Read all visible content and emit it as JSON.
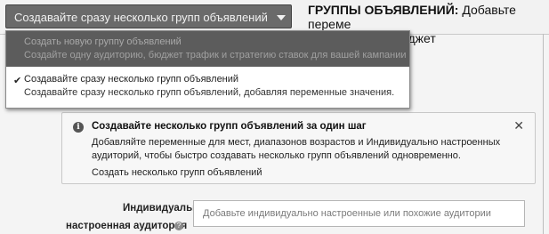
{
  "dropdown": {
    "selected_label": "Создавайте сразу несколько групп объявлений"
  },
  "header": {
    "title_bold": "ГРУППЫ ОБЪЯВЛЕНИЙ:",
    "title_rest": " Добавьте переме",
    "title_line2": "распределять бюджет"
  },
  "menu": {
    "items": [
      {
        "title": "Создать новую группу объявлений",
        "description": "Создайте одну аудиторию, бюджет трафик и стратегию ставок для вашей кампании",
        "selected": false
      },
      {
        "title": "Создавайте сразу несколько групп объявлений",
        "description": "Создавайте сразу несколько групп объявлений, добавляя переменные значения.",
        "selected": true
      }
    ],
    "check_glyph": "✔"
  },
  "info": {
    "icon": "i",
    "title": "Создавайте несколько групп объявлений за один шаг",
    "text": "Добавляйте переменные для мест, диапазонов возрастов и Индивидуально настроенных аудиторий, чтобы быстро создавать несколько групп объявлений одновременно.",
    "link": "Создать несколько групп объявлений",
    "close_glyph": "✕"
  },
  "audience": {
    "label_line1": "Индивидуально",
    "label_line2": "настроенная аудитория",
    "placeholder": "Добавьте индивидуально настроенные или похожие аудитории"
  },
  "icons": {
    "info_icon": "info-circle-icon",
    "help_icon": "question-circle-icon",
    "close_icon": "close-icon",
    "caret_icon": "chevron-down-icon",
    "check_icon": "checkmark-icon"
  },
  "colors": {
    "dropdown_bg": "#6a6a6a",
    "menu_highlight": "#5c5c5c",
    "info_bg": "#f7f7f7"
  }
}
